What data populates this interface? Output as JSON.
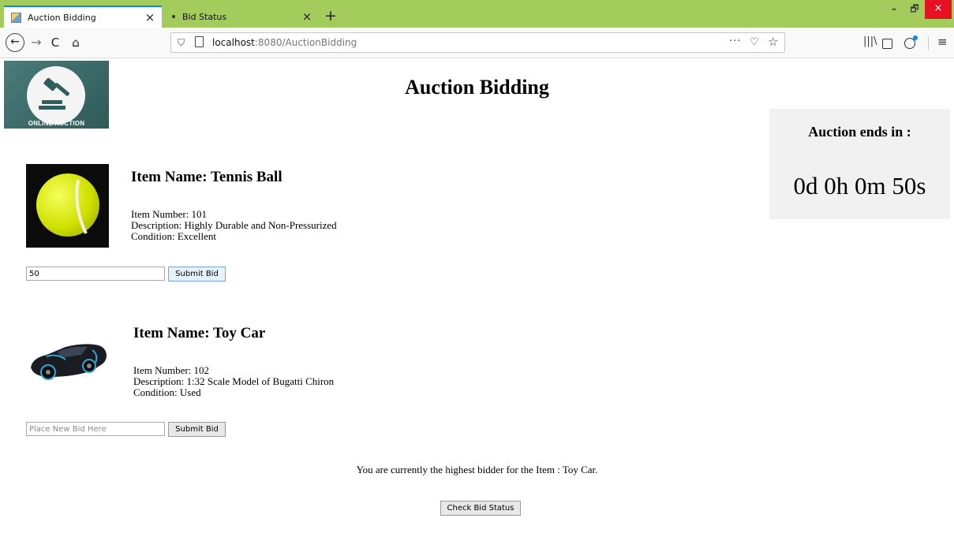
{
  "browser": {
    "tabs": [
      {
        "title": "Auction Bidding",
        "active": true
      },
      {
        "title": "Bid Status",
        "active": false
      }
    ],
    "url_host": "localhost",
    "url_path": ":8080/AuctionBidding",
    "icons": {
      "close": "×",
      "new_tab": "+",
      "back": "←",
      "forward": "→",
      "reload": "C",
      "home": "⌂",
      "shield": "⛉",
      "more": "···",
      "pocket": "♡",
      "star": "☆",
      "library": "|||\\",
      "menu": "≡",
      "minimize": "–",
      "maximize": "🗗",
      "window_close": "×"
    },
    "accent_color": "#a4cc5c"
  },
  "logo": {
    "text": "ONLINE AUCTION"
  },
  "page": {
    "title": "Auction Bidding"
  },
  "countdown": {
    "label": "Auction ends in :",
    "value": "0d 0h 0m 50s"
  },
  "items": [
    {
      "name": "Item Name: Tennis Ball",
      "number": "Item Number: 101",
      "description": "Description: Highly Durable and Non-Pressurized",
      "condition": "Condition: Excellent",
      "bid_value": "50",
      "bid_placeholder": "Place New Bid Here",
      "button": "Submit Bid"
    },
    {
      "name": "Item Name: Toy Car",
      "number": "Item Number: 102",
      "description": "Description: 1:32 Scale Model of Bugatti Chiron",
      "condition": "Condition: Used",
      "bid_value": "",
      "bid_placeholder": "Place New Bid Here",
      "button": "Submit Bid"
    }
  ],
  "status_message": "You are currently the highest bidder for the Item : Toy Car.",
  "check_button": "Check Bid Status"
}
